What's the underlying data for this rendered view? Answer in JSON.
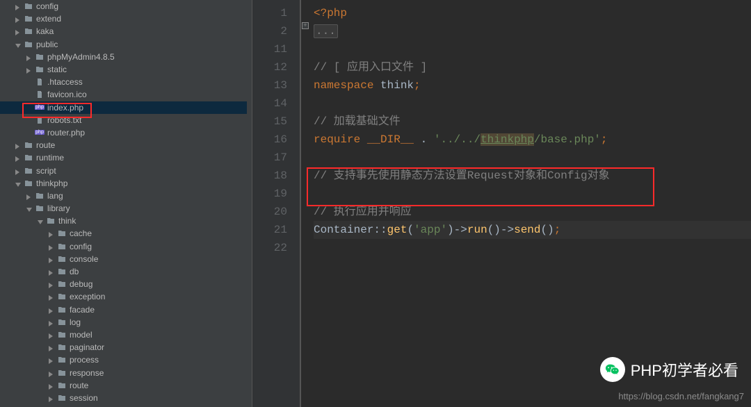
{
  "sidebar": {
    "items": [
      {
        "depth": 1,
        "arrow": "collapsed",
        "type": "folder",
        "label": "config"
      },
      {
        "depth": 1,
        "arrow": "collapsed",
        "type": "folder",
        "label": "extend"
      },
      {
        "depth": 1,
        "arrow": "collapsed",
        "type": "folder",
        "label": "kaka"
      },
      {
        "depth": 1,
        "arrow": "expanded",
        "type": "folder",
        "label": "public"
      },
      {
        "depth": 2,
        "arrow": "collapsed",
        "type": "folder",
        "label": "phpMyAdmin4.8.5"
      },
      {
        "depth": 2,
        "arrow": "collapsed",
        "type": "folder",
        "label": "static"
      },
      {
        "depth": 2,
        "arrow": "none",
        "type": "file",
        "label": ".htaccess"
      },
      {
        "depth": 2,
        "arrow": "none",
        "type": "file",
        "label": "favicon.ico"
      },
      {
        "depth": 2,
        "arrow": "none",
        "type": "php",
        "label": "index.php",
        "selected": true
      },
      {
        "depth": 2,
        "arrow": "none",
        "type": "file",
        "label": "robots.txt"
      },
      {
        "depth": 2,
        "arrow": "none",
        "type": "php",
        "label": "router.php"
      },
      {
        "depth": 1,
        "arrow": "collapsed",
        "type": "folder",
        "label": "route"
      },
      {
        "depth": 1,
        "arrow": "collapsed",
        "type": "folder",
        "label": "runtime"
      },
      {
        "depth": 1,
        "arrow": "collapsed",
        "type": "folder",
        "label": "script"
      },
      {
        "depth": 1,
        "arrow": "expanded",
        "type": "folder",
        "label": "thinkphp"
      },
      {
        "depth": 2,
        "arrow": "collapsed",
        "type": "folder",
        "label": "lang"
      },
      {
        "depth": 2,
        "arrow": "expanded",
        "type": "folder",
        "label": "library"
      },
      {
        "depth": 3,
        "arrow": "expanded",
        "type": "folder",
        "label": "think"
      },
      {
        "depth": 4,
        "arrow": "collapsed",
        "type": "folder",
        "label": "cache"
      },
      {
        "depth": 4,
        "arrow": "collapsed",
        "type": "folder",
        "label": "config"
      },
      {
        "depth": 4,
        "arrow": "collapsed",
        "type": "folder",
        "label": "console"
      },
      {
        "depth": 4,
        "arrow": "collapsed",
        "type": "folder",
        "label": "db"
      },
      {
        "depth": 4,
        "arrow": "collapsed",
        "type": "folder",
        "label": "debug"
      },
      {
        "depth": 4,
        "arrow": "collapsed",
        "type": "folder",
        "label": "exception"
      },
      {
        "depth": 4,
        "arrow": "collapsed",
        "type": "folder",
        "label": "facade"
      },
      {
        "depth": 4,
        "arrow": "collapsed",
        "type": "folder",
        "label": "log"
      },
      {
        "depth": 4,
        "arrow": "collapsed",
        "type": "folder",
        "label": "model"
      },
      {
        "depth": 4,
        "arrow": "collapsed",
        "type": "folder",
        "label": "paginator"
      },
      {
        "depth": 4,
        "arrow": "collapsed",
        "type": "folder",
        "label": "process"
      },
      {
        "depth": 4,
        "arrow": "collapsed",
        "type": "folder",
        "label": "response"
      },
      {
        "depth": 4,
        "arrow": "collapsed",
        "type": "folder",
        "label": "route"
      },
      {
        "depth": 4,
        "arrow": "collapsed",
        "type": "folder",
        "label": "session"
      }
    ]
  },
  "editor": {
    "line_numbers": [
      "1",
      "2",
      "11",
      "12",
      "13",
      "14",
      "15",
      "16",
      "17",
      "18",
      "19",
      "20",
      "21",
      "22"
    ],
    "code": {
      "php_open": "<?php",
      "fold_text": "...",
      "c1": "// [ 应用入口文件 ]",
      "ns_key": "namespace ",
      "ns_name": "think",
      "c2": "// 加载基础文件",
      "require_key": "require ",
      "dir_magic": "__DIR__",
      "dot_op": " . ",
      "path_pre": "'../../",
      "path_link": "thinkphp",
      "path_post": "/base.php'",
      "c3": "// 支持事先使用静态方法设置Request对象和Config对象",
      "c4": "// 执行应用并响应",
      "container_line": {
        "class": "Container",
        "double_colon": "::",
        "get": "get",
        "paren_open": "(",
        "arg": "'app'",
        "paren_close": ")",
        "arrow": "->",
        "run": "run",
        "parens": "()",
        "send": "send"
      },
      "semi": ";"
    }
  },
  "overlay": {
    "wechat_text": "PHP初学者必看",
    "watermark_url": "https://blog.csdn.net/fangkang7"
  }
}
